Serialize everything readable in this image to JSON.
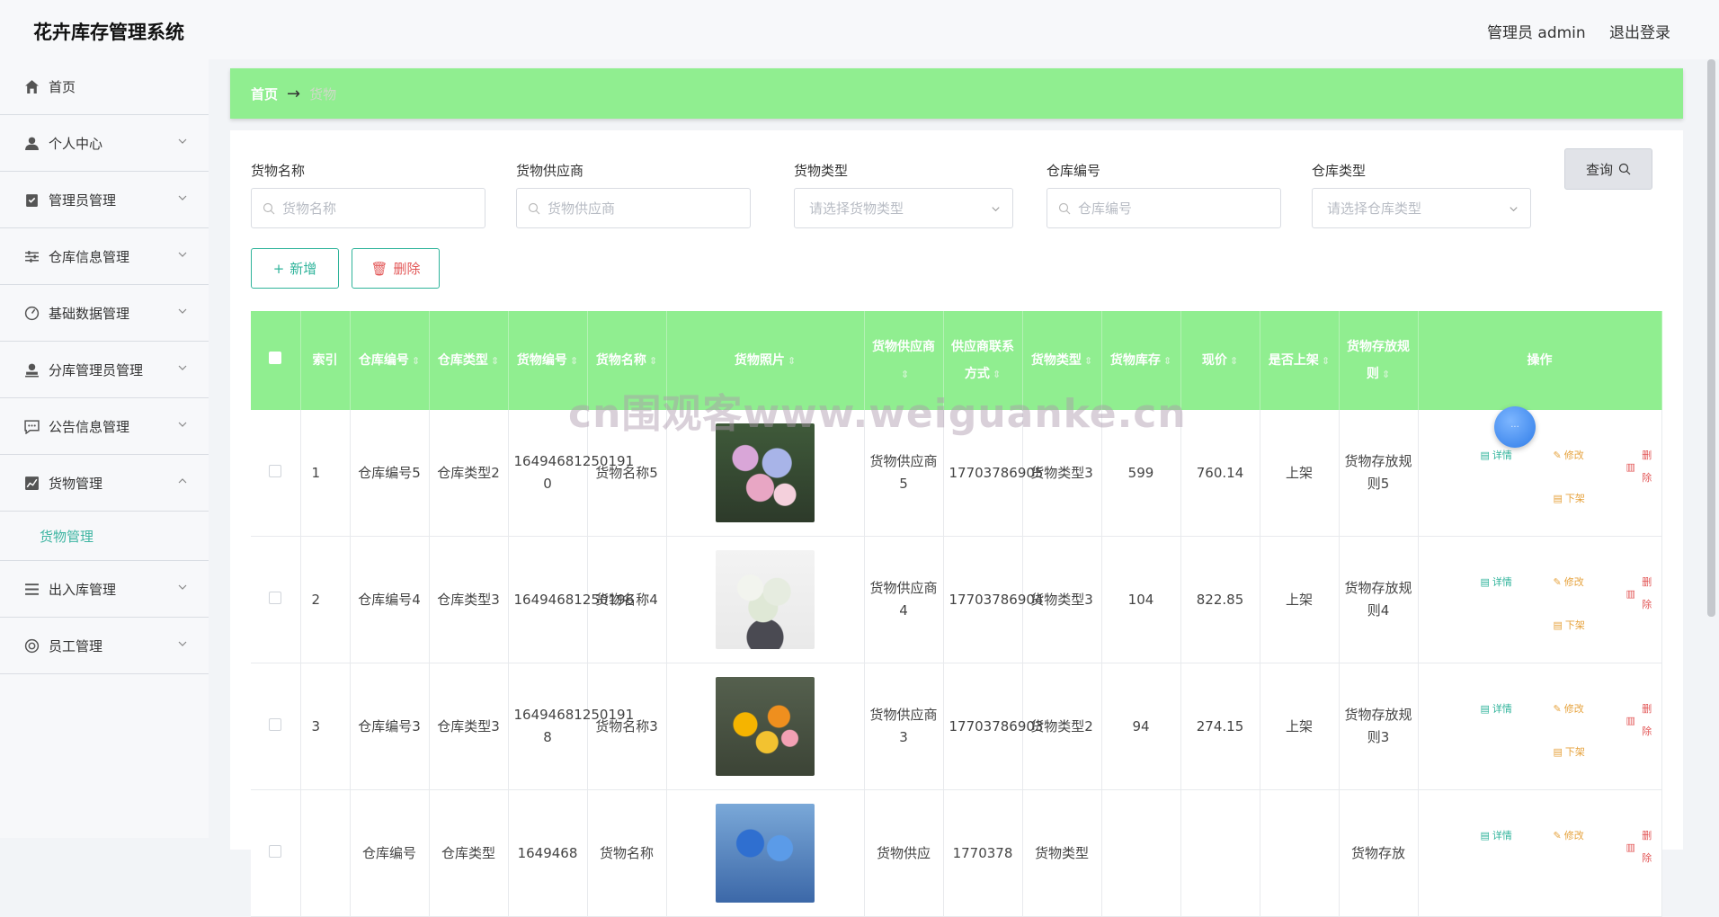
{
  "app": {
    "title": "花卉库存管理系统",
    "user": "管理员 admin",
    "logout": "退出登录"
  },
  "sidebar": {
    "items": [
      {
        "label": "首页"
      },
      {
        "label": "个人中心"
      },
      {
        "label": "管理员管理"
      },
      {
        "label": "仓库信息管理"
      },
      {
        "label": "基础数据管理"
      },
      {
        "label": "分库管理员管理"
      },
      {
        "label": "公告信息管理"
      },
      {
        "label": "货物管理"
      },
      {
        "label": "出入库管理"
      },
      {
        "label": "员工管理"
      }
    ],
    "active_sub": "货物管理"
  },
  "breadcrumb": {
    "home": "首页",
    "arrow": "→",
    "current": "货物"
  },
  "filters": {
    "name": {
      "label": "货物名称",
      "placeholder": "货物名称"
    },
    "supplier": {
      "label": "货物供应商",
      "placeholder": "货物供应商"
    },
    "type": {
      "label": "货物类型",
      "placeholder": "请选择货物类型"
    },
    "warehouse_no": {
      "label": "仓库编号",
      "placeholder": "仓库编号"
    },
    "warehouse_type": {
      "label": "仓库类型",
      "placeholder": "请选择仓库类型"
    },
    "query": "查询"
  },
  "actions": {
    "add": "新增",
    "delete": "删除"
  },
  "table": {
    "headers": [
      "索引",
      "仓库编号",
      "仓库类型",
      "货物编号",
      "货物名称",
      "货物照片",
      "货物供应商",
      "供应商联系方式",
      "货物类型",
      "货物库存",
      "现价",
      "是否上架",
      "货物存放规则",
      "操作"
    ],
    "rows": [
      {
        "index": "1",
        "wh_no": "仓库编号5",
        "wh_type": "仓库类型2",
        "goods_no": "16494681250191 0",
        "goods_name": "货物名称5",
        "supplier": "货物供应商5",
        "phone": "17703786905",
        "goods_type": "货物类型3",
        "stock": "599",
        "price": "760.14",
        "on_shelf": "上架",
        "rule": "货物存放规则5"
      },
      {
        "index": "2",
        "wh_no": "仓库编号4",
        "wh_type": "仓库类型3",
        "goods_no": "16494681250196",
        "goods_name": "货物名称4",
        "supplier": "货物供应商4",
        "phone": "17703786904",
        "goods_type": "货物类型3",
        "stock": "104",
        "price": "822.85",
        "on_shelf": "上架",
        "rule": "货物存放规则4"
      },
      {
        "index": "3",
        "wh_no": "仓库编号3",
        "wh_type": "仓库类型3",
        "goods_no": "16494681250191 8",
        "goods_name": "货物名称3",
        "supplier": "货物供应商3",
        "phone": "17703786903",
        "goods_type": "货物类型2",
        "stock": "94",
        "price": "274.15",
        "on_shelf": "上架",
        "rule": "货物存放规则3"
      },
      {
        "index": "",
        "wh_no": "仓库编号",
        "wh_type": "仓库类型",
        "goods_no": "1649468",
        "goods_name": "货物名称",
        "supplier": "货物供应",
        "phone": "1770378",
        "goods_type": "货物类型",
        "stock": "",
        "price": "",
        "on_shelf": "",
        "rule": "货物存放"
      }
    ],
    "ops": {
      "detail": "详情",
      "edit": "修改",
      "delete": "删除",
      "off": "下架"
    }
  },
  "watermark": "cn围观客www.weiguanke.cn",
  "colors": {
    "accent": "#90ee90",
    "teal": "#2eb39a",
    "danger": "#e25555",
    "warn": "#e6a23c"
  }
}
